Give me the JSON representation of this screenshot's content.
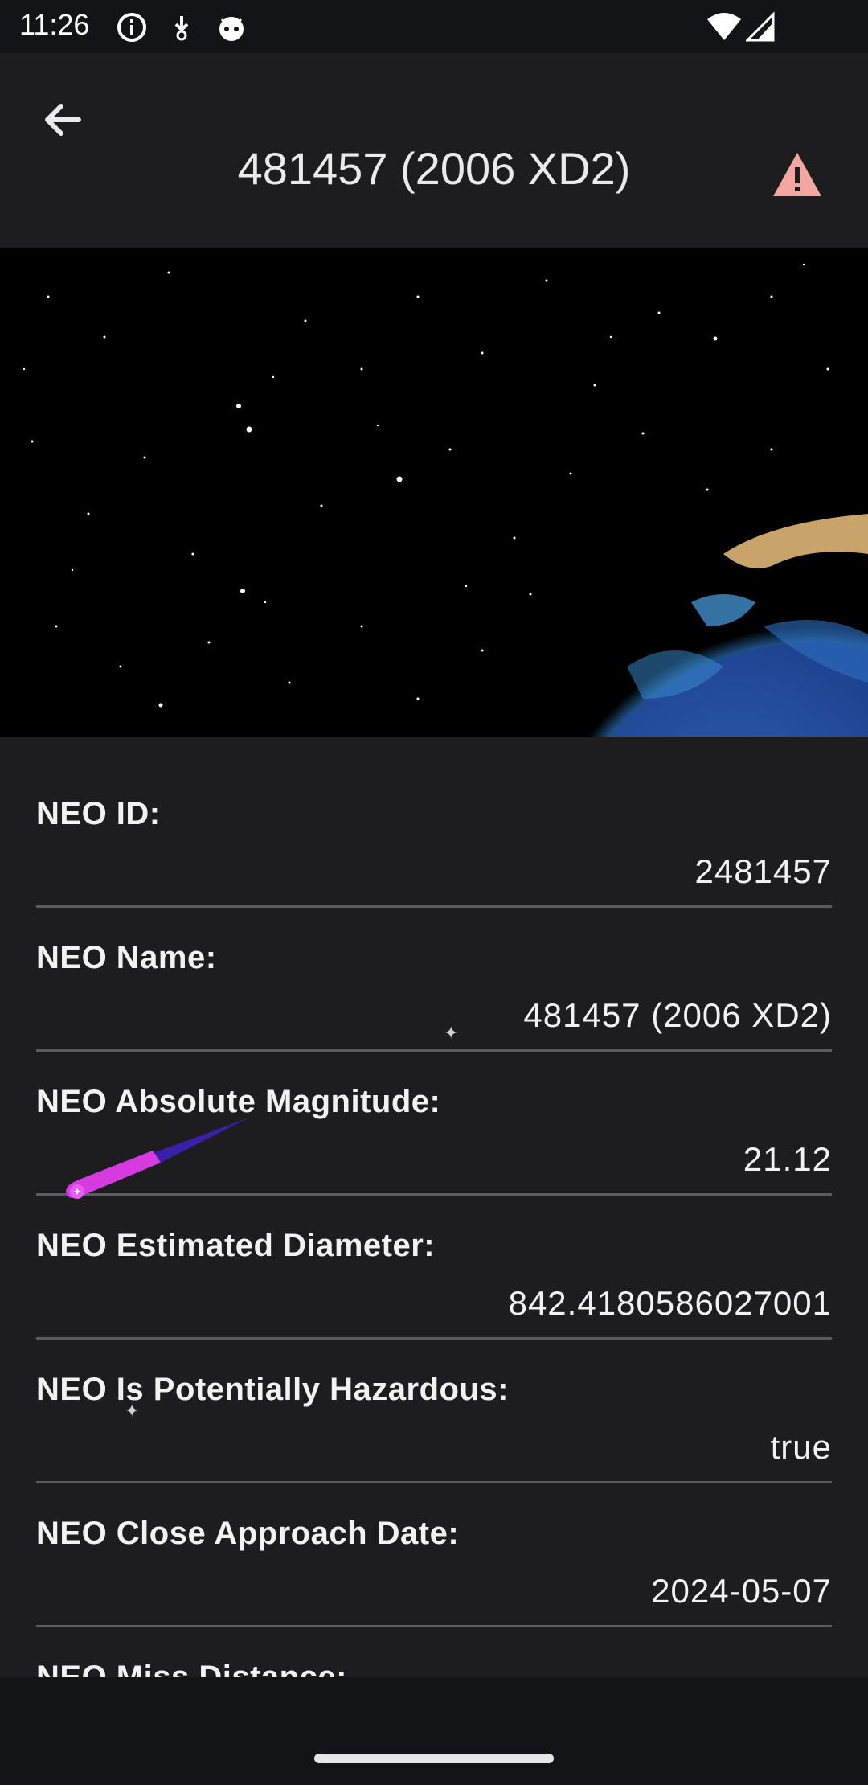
{
  "status_bar": {
    "time": "11:26",
    "left_icons": [
      "info-icon",
      "download-icon",
      "android-face-icon"
    ],
    "right_icons": [
      "wifi-icon",
      "cell-signal-icon"
    ]
  },
  "app_bar": {
    "title": "481457 (2006 XD2)",
    "back_icon": "arrow-back-icon",
    "action_icon": "warning-triangle-icon",
    "warning_color": "#f4a7a0"
  },
  "hero": {
    "description_icon": "earth-icon"
  },
  "fields": [
    {
      "label": "NEO ID:",
      "value": "2481457"
    },
    {
      "label": "NEO Name:",
      "value": "481457 (2006 XD2)"
    },
    {
      "label": "NEO Absolute Magnitude:",
      "value": "21.12"
    },
    {
      "label": "NEO Estimated Diameter:",
      "value": "842.4180586027001"
    },
    {
      "label": "NEO Is Potentially Hazardous:",
      "value": "true"
    },
    {
      "label": "NEO Close Approach Date:",
      "value": "2024-05-07"
    },
    {
      "label": "NEO Miss Distance:",
      "value": ""
    }
  ],
  "colors": {
    "background": "#131417",
    "surface": "#1d1d20",
    "divider": "#5b5b5f",
    "comet": "#d63be0"
  }
}
